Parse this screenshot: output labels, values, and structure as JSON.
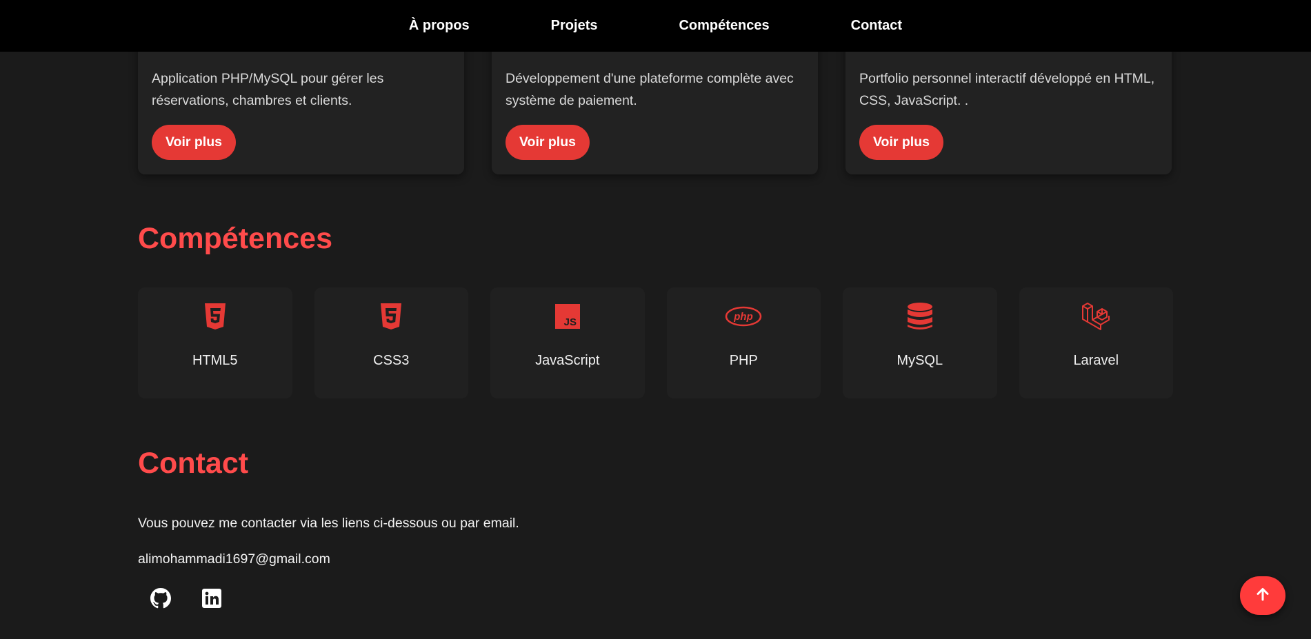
{
  "nav": {
    "items": [
      "À propos",
      "Projets",
      "Compétences",
      "Contact"
    ]
  },
  "projects": [
    {
      "description": "Application PHP/MySQL pour gérer les réservations, chambres et clients.",
      "button": "Voir plus"
    },
    {
      "description": "Développement d'une plateforme complète avec système de paiement.",
      "button": "Voir plus"
    },
    {
      "description": "Portfolio personnel interactif développé en HTML, CSS, JavaScript. .",
      "button": "Voir plus"
    }
  ],
  "skills": {
    "title": "Compétences",
    "items": [
      {
        "label": "HTML5",
        "icon": "html5-icon"
      },
      {
        "label": "CSS3",
        "icon": "css3-icon"
      },
      {
        "label": "JavaScript",
        "icon": "javascript-icon"
      },
      {
        "label": "PHP",
        "icon": "php-icon"
      },
      {
        "label": "MySQL",
        "icon": "database-icon"
      },
      {
        "label": "Laravel",
        "icon": "laravel-icon"
      }
    ]
  },
  "contact": {
    "title": "Contact",
    "text": "Vous pouvez me contacter via les liens ci-dessous ou par email.",
    "email": "alimohammadi1697@gmail.com",
    "social": [
      "github-icon",
      "linkedin-icon"
    ]
  },
  "colors": {
    "accent": "#e53935",
    "heading": "#ff4b4b",
    "background": "#1b1b1b",
    "nav_bg": "#000000",
    "card_bg": "#222222"
  }
}
